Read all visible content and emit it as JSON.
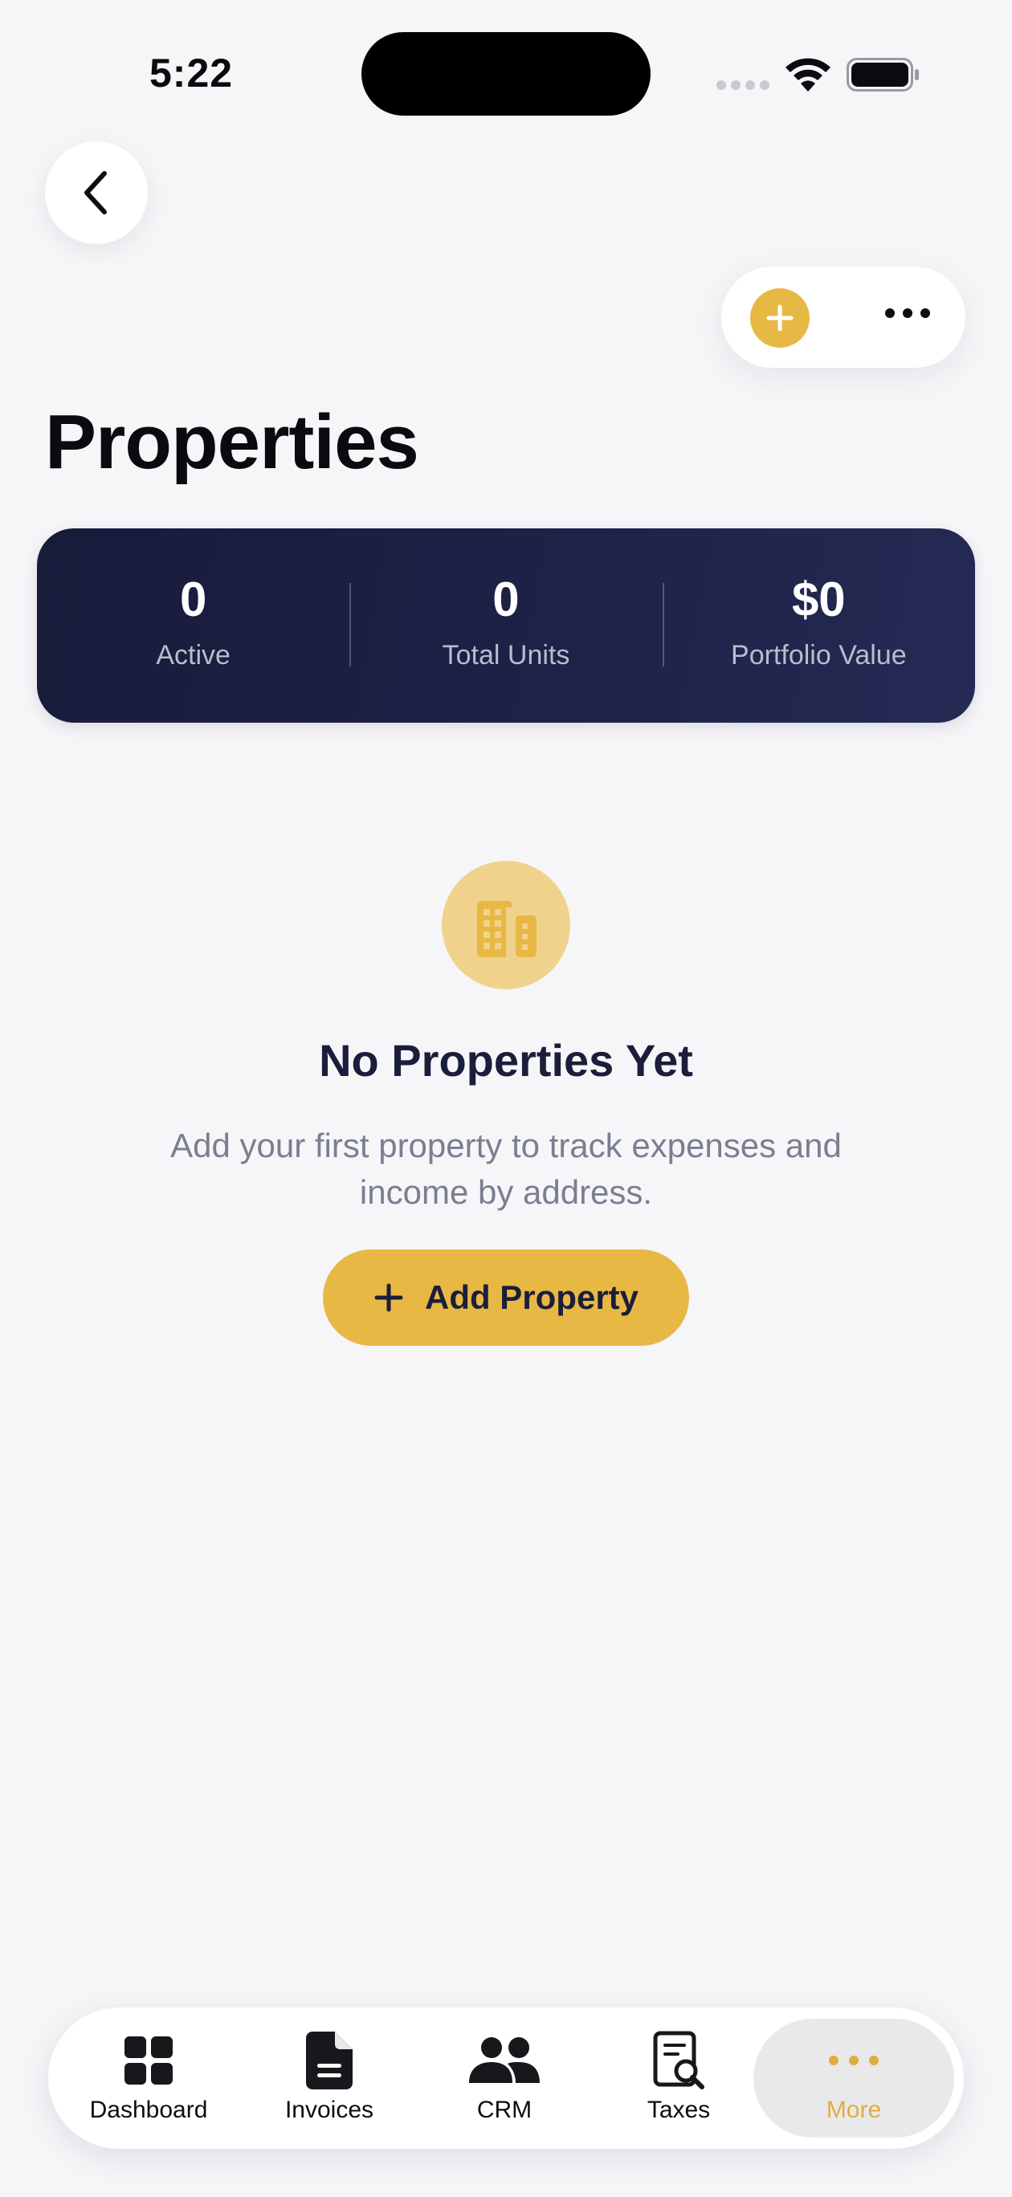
{
  "status_bar": {
    "time": "5:22"
  },
  "header": {
    "title": "Properties"
  },
  "stats": [
    {
      "value": "0",
      "label": "Active"
    },
    {
      "value": "0",
      "label": "Total Units"
    },
    {
      "value": "$0",
      "label": "Portfolio Value"
    }
  ],
  "empty_state": {
    "title": "No Properties Yet",
    "description": "Add your first property to track expenses and income by address.",
    "button_label": "Add Property"
  },
  "tab_bar": {
    "items": [
      {
        "label": "Dashboard",
        "icon": "grid-icon"
      },
      {
        "label": "Invoices",
        "icon": "document-icon"
      },
      {
        "label": "CRM",
        "icon": "people-icon"
      },
      {
        "label": "Taxes",
        "icon": "receipt-search-icon"
      },
      {
        "label": "More",
        "icon": "ellipsis-icon",
        "selected": true
      }
    ]
  },
  "colors": {
    "accent": "#e8b844",
    "navy": "#1b1e3b",
    "background": "#f6f6f9"
  }
}
